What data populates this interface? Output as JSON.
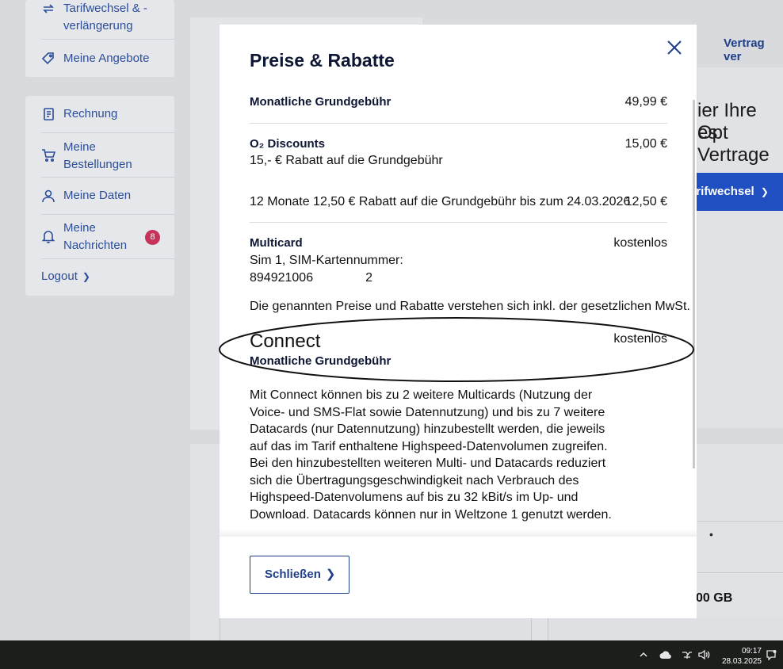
{
  "sidebar": {
    "top_items": [
      {
        "label_line1": "Tarifwechsel & -",
        "label_line2": "verlängerung",
        "icon": "exchange-arrows-icon"
      },
      {
        "label": "Meine Angebote",
        "icon": "tag-icon"
      }
    ],
    "items": [
      {
        "label": "Rechnung",
        "icon": "invoice-icon"
      },
      {
        "label_line1": "Meine",
        "label_line2": "Bestellungen",
        "icon": "cart-icon"
      },
      {
        "label": "Meine Daten",
        "icon": "user-icon"
      },
      {
        "label_line1": "Meine",
        "label_line2": "Nachrichten",
        "icon": "bell-icon",
        "badge": "8"
      }
    ],
    "logout": "Logout"
  },
  "background": {
    "link_right": "Vertrag ver",
    "heading_line1": "ier Ihre Opt",
    "heading_line2": "es Vertrage",
    "tariff_button": "arifwechsel",
    "dot": "•",
    "data_amount": "00 GB"
  },
  "modal": {
    "title": "Preise & Rabatte",
    "rows": {
      "base_fee_label": "Monatliche Grundgebühr",
      "base_fee_value": "49,99 €",
      "discounts_label": "O₂ Discounts",
      "discounts_value": "15,00 €",
      "discounts_text": "15,- € Rabatt auf die Grundgebühr",
      "promo_text": "12 Monate 12,50 € Rabatt auf die Grundgebühr bis zum 24.03.2026",
      "promo_value": "12,50 €",
      "multicard_label": "Multicard",
      "multicard_value": "kostenlos",
      "sim_line": "Sim 1, SIM-Kartennummer:",
      "sim_number_start": "894921006",
      "sim_number_end": "2",
      "vat_note": "Die genannten Preise und Rabatte verstehen sich inkl. der gesetzlichen MwSt."
    },
    "connect": {
      "title": "Connect",
      "value": "kostenlos",
      "sublabel": "Monatliche Grundgebühr",
      "description": "Mit Connect können bis zu 2 weitere Multicards (Nutzung der Voice- und SMS-Flat sowie Datennutzung) und bis zu 7 weitere Datacards (nur Datennutzung) hinzubestellt werden, die jeweils auf das im Tarif enthaltene Highspeed-Datenvolumen zugreifen. Bei den hinzubestellten weiteren Multi- und Datacards reduziert sich die Übertragungsgeschwindigkeit nach Verbrauch des Highspeed-Datenvolumens auf bis zu 32 kBit/s im Up- und Download. Datacards können nur in Weltzone 1 genutzt werden."
    },
    "close_button": "Schließen"
  },
  "taskbar": {
    "time": "09:17",
    "date": "28.03.2025"
  },
  "colors": {
    "brand_blue": "#1f4fc0",
    "link_blue": "#2a4e9a",
    "badge_red": "#c8325a"
  }
}
